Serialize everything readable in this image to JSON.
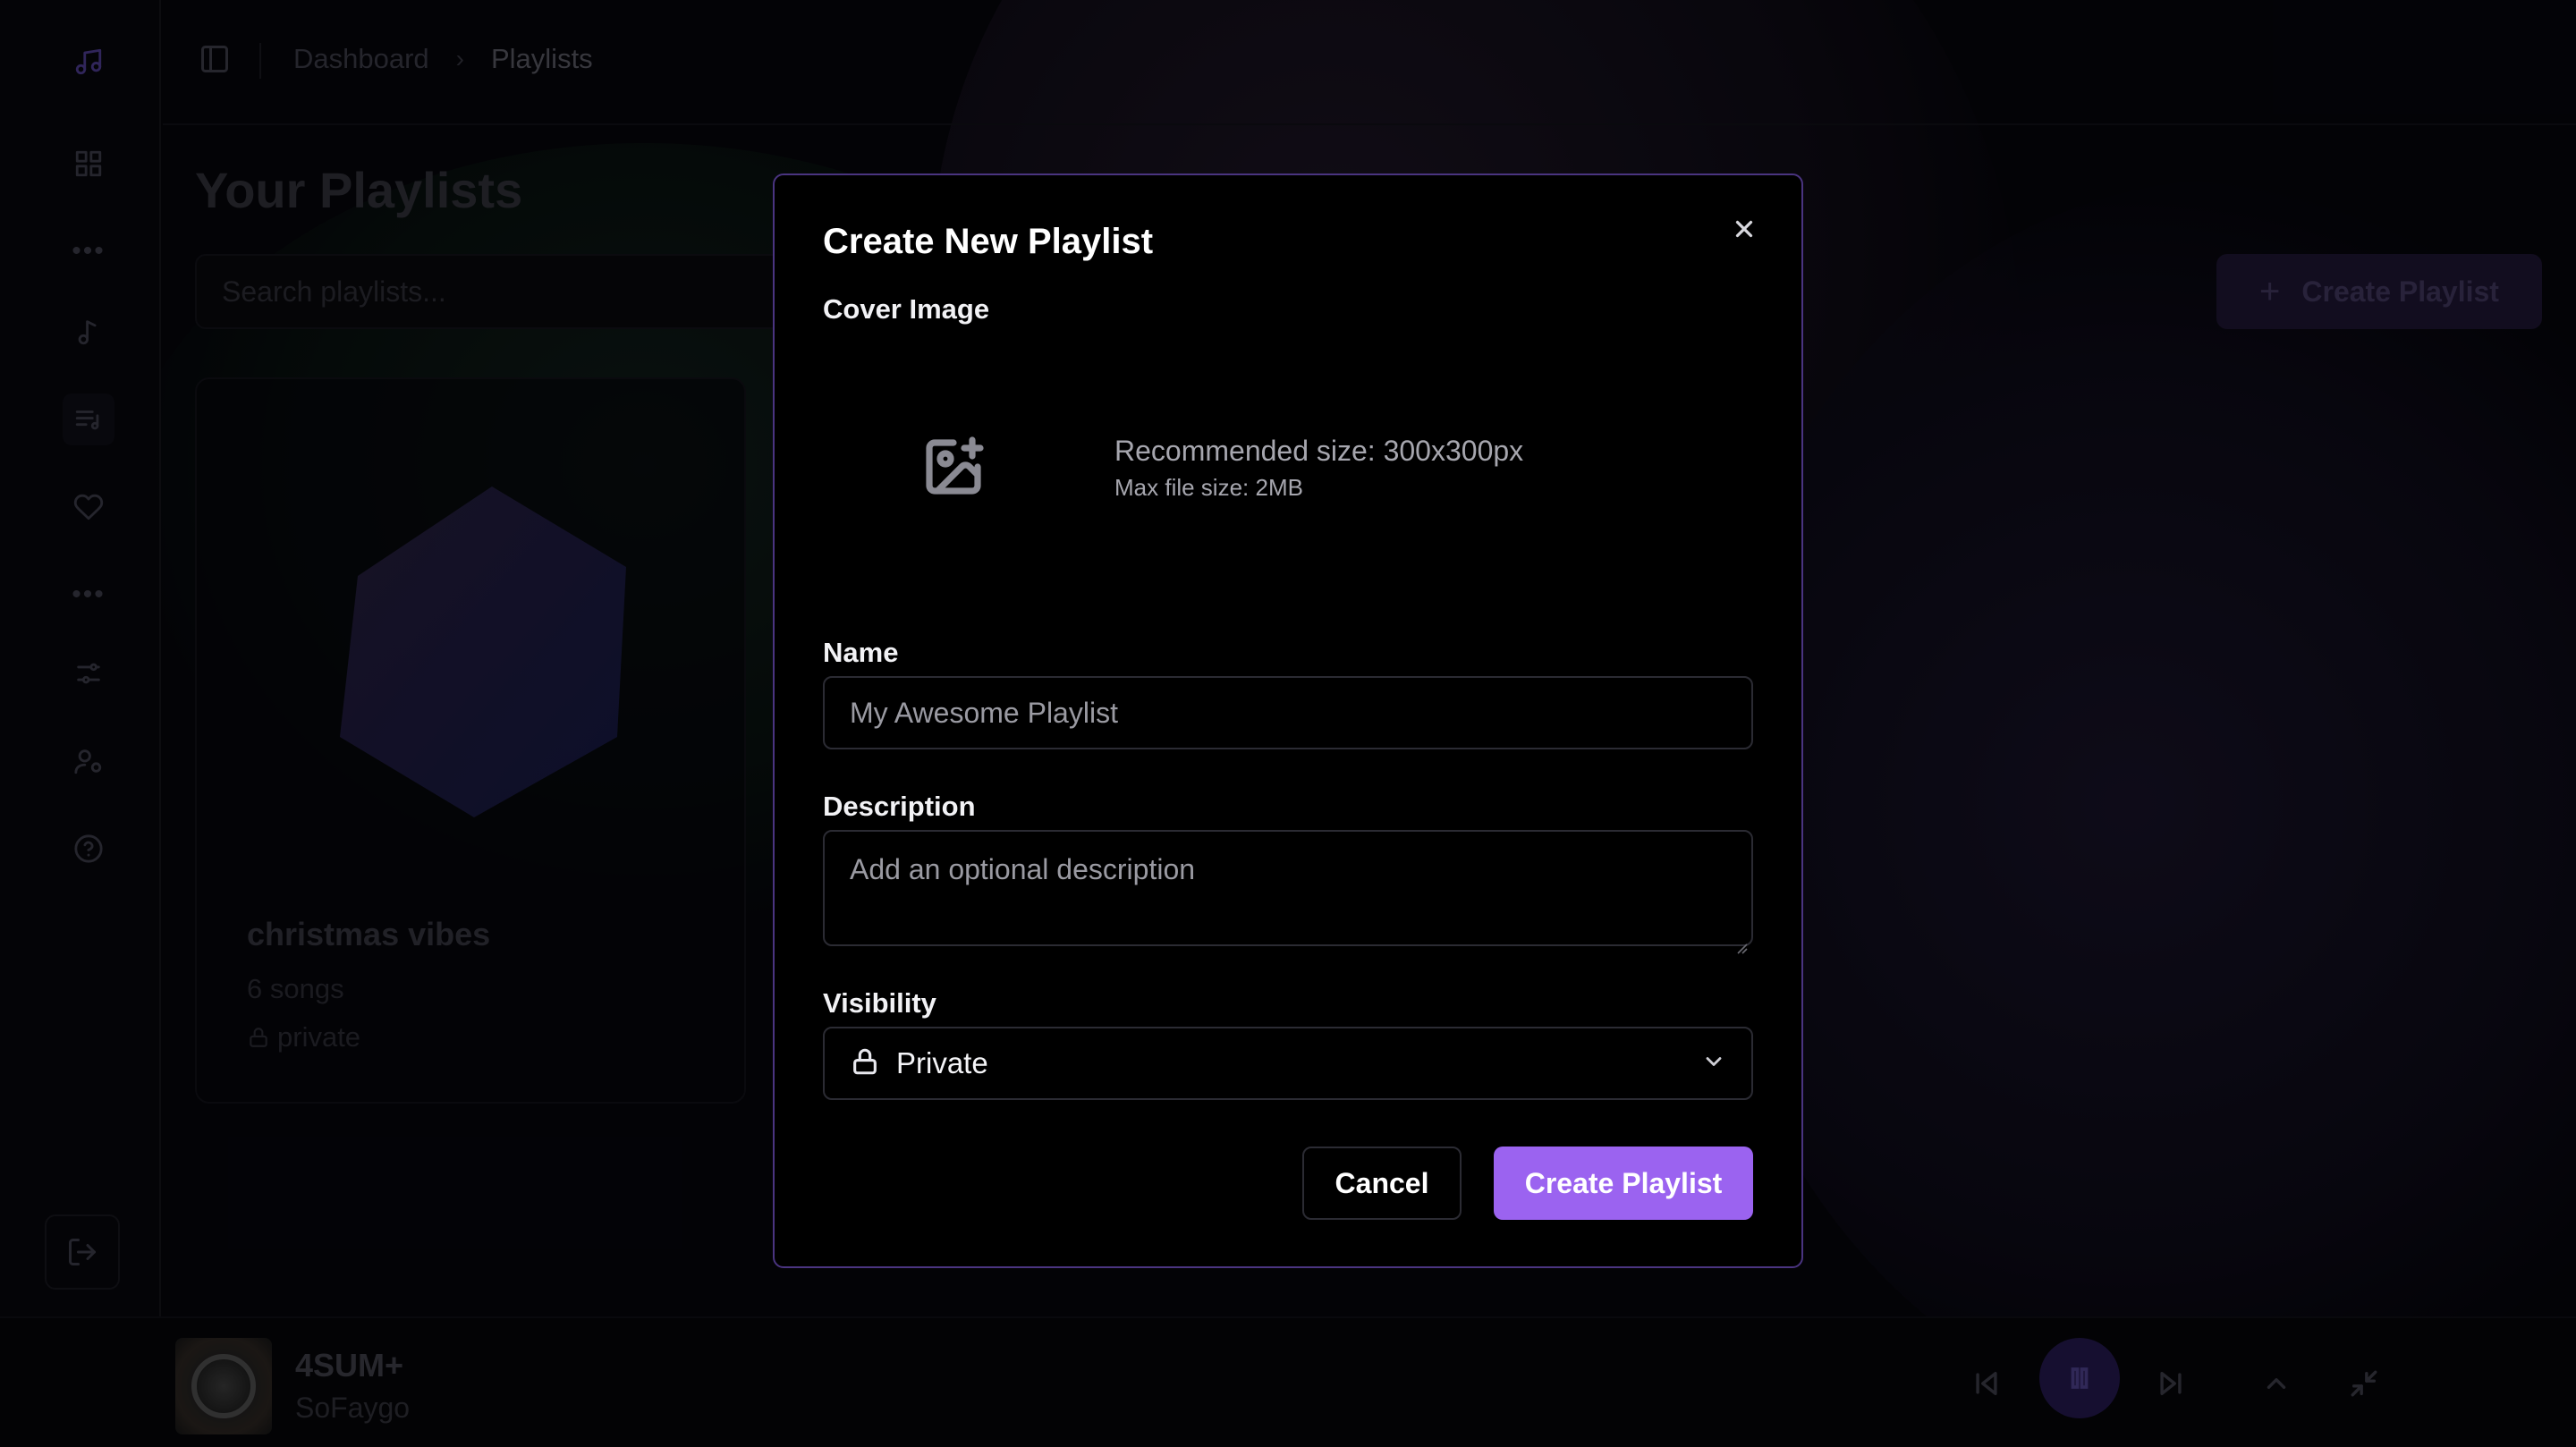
{
  "header": {
    "breadcrumb": [
      "Dashboard",
      "Playlists"
    ]
  },
  "page": {
    "title": "Your Playlists",
    "search_placeholder": "Search playlists...",
    "create_button": "Create Playlist"
  },
  "playlist_card": {
    "title": "christmas vibes",
    "songs": "6 songs",
    "visibility": "private"
  },
  "player": {
    "track": "4SUM+",
    "artist": "SoFaygo"
  },
  "modal": {
    "title": "Create New Playlist",
    "cover_label": "Cover Image",
    "recommended": "Recommended size: 300x300px",
    "max_size": "Max file size: 2MB",
    "name_label": "Name",
    "name_placeholder": "My Awesome Playlist",
    "description_label": "Description",
    "description_placeholder": "Add an optional description",
    "visibility_label": "Visibility",
    "visibility_value": "Private",
    "cancel": "Cancel",
    "create": "Create Playlist"
  },
  "colors": {
    "accent": "#9b63f0",
    "modal_border": "#4a3480"
  }
}
